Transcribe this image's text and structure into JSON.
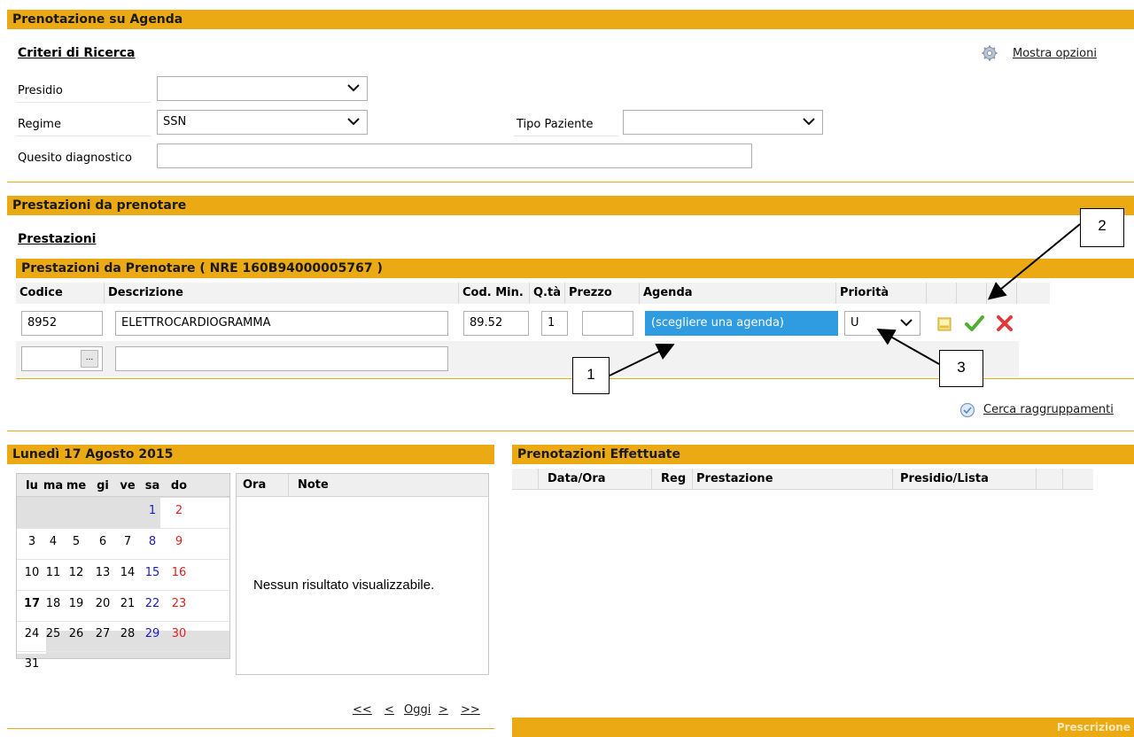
{
  "booking": {
    "title": "Prenotazione su Agenda",
    "criteria_title": "Criteri di Ricerca",
    "show_options": "Mostra opzioni",
    "presidio_label": "Presidio",
    "presidio_value": "",
    "regime_label": "Regime",
    "regime_value": "SSN",
    "tipo_paziente_label": "Tipo Paziente",
    "tipo_paziente_value": "",
    "quesito_label": "Quesito diagnostico",
    "quesito_value": ""
  },
  "services": {
    "title": "Prestazioni da prenotare",
    "subtitle": "Prestazioni",
    "table_title": "Prestazioni da Prenotare ( NRE 160B94000005767 )",
    "columns": {
      "codice": "Codice",
      "descrizione": "Descrizione",
      "cod_min": "Cod. Min.",
      "qta": "Q.tà",
      "prezzo": "Prezzo",
      "agenda": "Agenda",
      "priorita": "Priorità"
    },
    "row": {
      "codice": "8952",
      "descrizione": "ELETTROCARDIOGRAMMA",
      "cod_min": "89.52",
      "qta": "1",
      "prezzo": "",
      "agenda": "(scegliere una agenda)",
      "priorita": "U"
    },
    "ellipsis": "...",
    "cerca_raggruppamenti": "Cerca raggruppamenti"
  },
  "calendar": {
    "title": "Lunedì 17 Agosto 2015",
    "days": [
      "lu",
      "ma",
      "me",
      "gi",
      "ve",
      "sa",
      "do"
    ],
    "weeks": [
      [
        "",
        "",
        "",
        "",
        "",
        "1",
        "2"
      ],
      [
        "3",
        "4",
        "5",
        "6",
        "7",
        "8",
        "9"
      ],
      [
        "10",
        "11",
        "12",
        "13",
        "14",
        "15",
        "16"
      ],
      [
        "17",
        "18",
        "19",
        "20",
        "21",
        "22",
        "23"
      ],
      [
        "24",
        "25",
        "26",
        "27",
        "28",
        "29",
        "30"
      ],
      [
        "31",
        "",
        "",
        "",
        "",
        "",
        ""
      ]
    ],
    "selected_day": "17",
    "ora_header": "Ora",
    "note_header": "Note",
    "empty_text": "Nessun risultato visualizzabile.",
    "nav": {
      "first": "<<",
      "prev": "<",
      "today": "Oggi",
      "next": ">",
      "last": ">>"
    }
  },
  "bookings_done": {
    "title": "Prenotazioni Effettuate",
    "columns": {
      "data_ora": "Data/Ora",
      "reg": "Reg",
      "prestazione": "Prestazione",
      "presidio_lista": "Presidio/Lista"
    },
    "footer": "Prescrizione"
  },
  "annotations": {
    "a1": "1",
    "a2": "2",
    "a3": "3"
  },
  "colors": {
    "band": "#ebaa14",
    "agenda_highlight": "#2f9be0",
    "sunday": "#e02020",
    "saturday": "#1a1acc"
  }
}
